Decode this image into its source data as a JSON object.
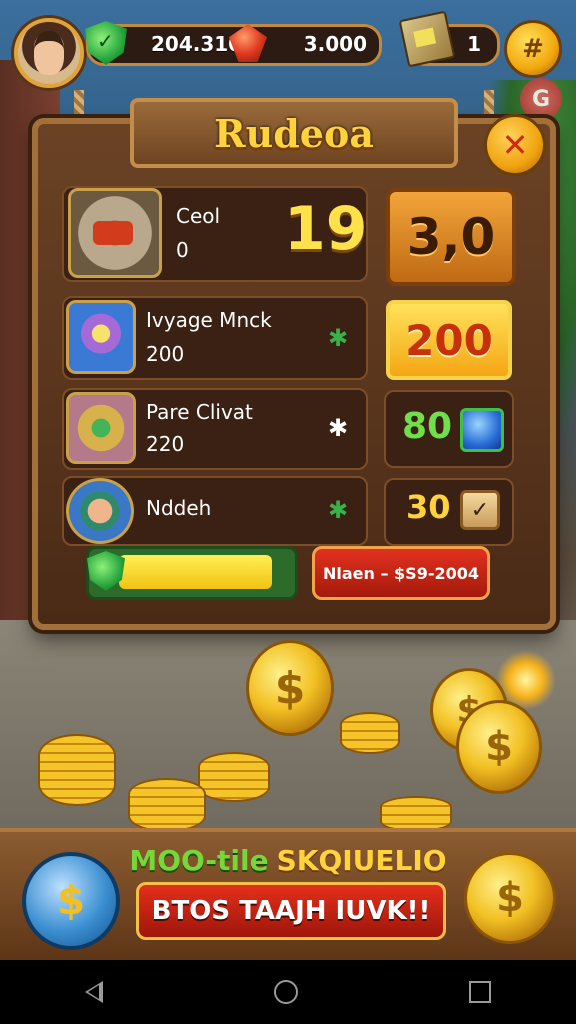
{
  "hud": {
    "currency_value": "204.3100",
    "secondary_value": "3.000",
    "crate_count": "1",
    "menu_icon": "#",
    "small_button_label": "G"
  },
  "dialog": {
    "title": "Rudeoa",
    "close_icon": "✕"
  },
  "rows": [
    {
      "name": "Ceol",
      "sub": "0",
      "amount": "19",
      "price": "3,0"
    },
    {
      "name": "Ivyage Mnck",
      "sub": "200",
      "clover": "✱",
      "price": "200"
    },
    {
      "name": "Pare Clivat",
      "sub": "220",
      "clover": "✱",
      "price": "80"
    },
    {
      "name": "Nddeh",
      "clover": "✱",
      "price": "30",
      "check": "✓"
    }
  ],
  "progress": {
    "fraction": 0.92
  },
  "promo_button": "Nlaen – $S9-2004",
  "coin_symbol": "$",
  "banner": {
    "top_left": "MOO-tile",
    "top_right": "SKQIUELIO",
    "bottom": "BTOS TAAJH IUVK!!"
  },
  "colors": {
    "accent_gold": "#ffd33d",
    "panel_wood": "#6b4224",
    "price_red": "#c7310a",
    "gem_green": "#6fe04a"
  }
}
